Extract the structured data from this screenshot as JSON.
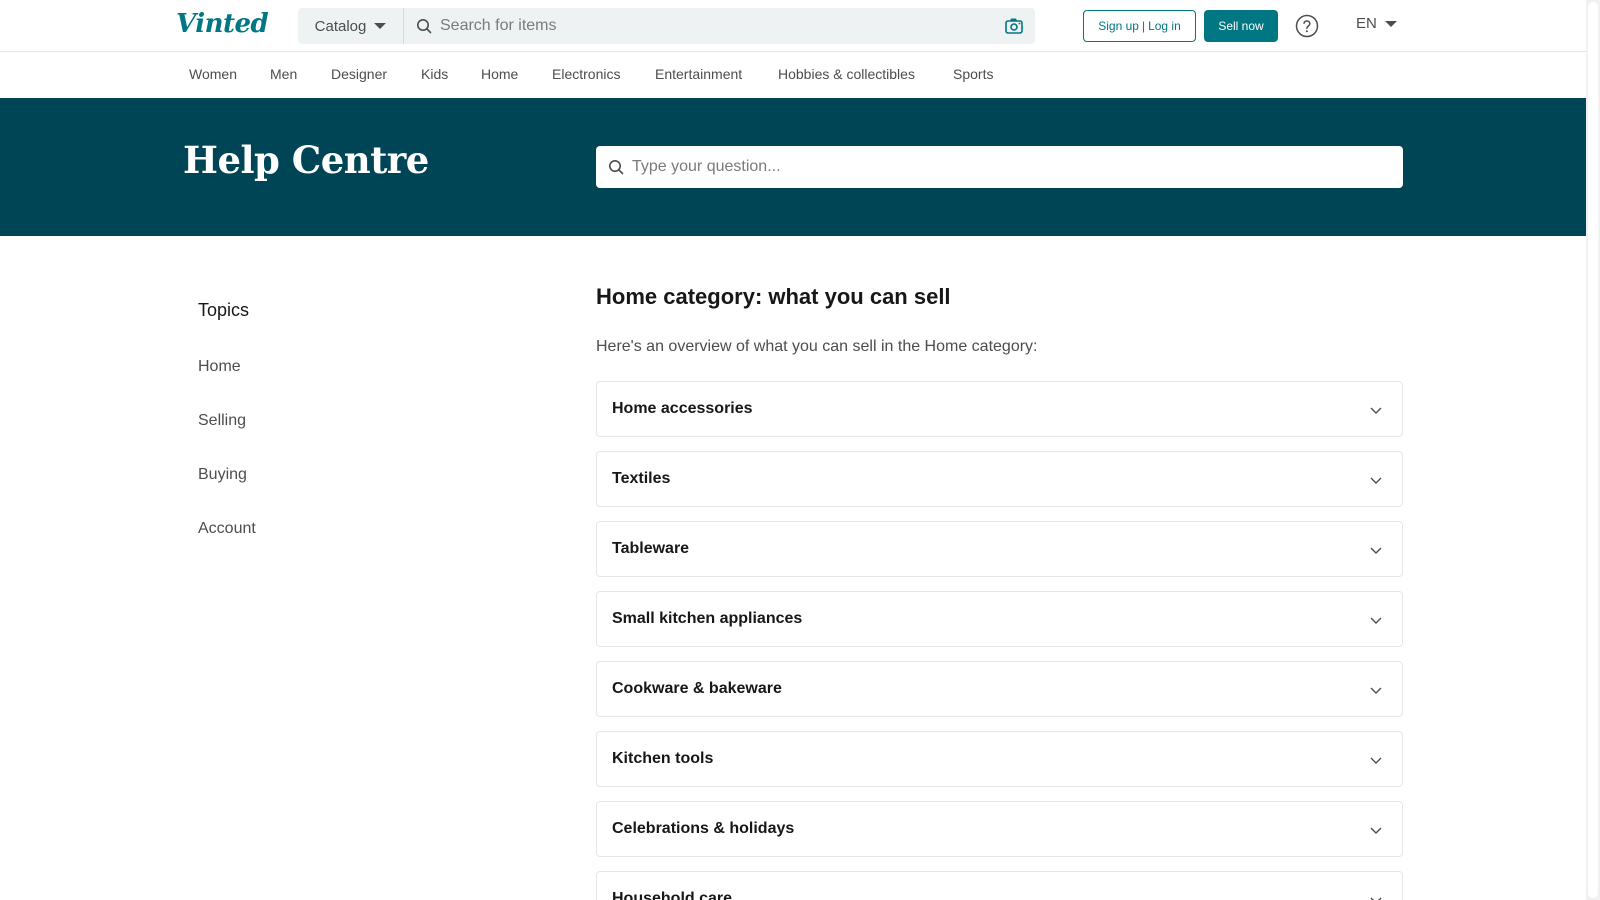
{
  "header": {
    "logo": "Vinted",
    "catalog_label": "Catalog",
    "search_placeholder": "Search for items",
    "signup_label": "Sign up",
    "separator": "|",
    "login_label": "Log in",
    "sell_label": "Sell now",
    "language": "EN"
  },
  "category_nav": [
    "Women",
    "Men",
    "Designer",
    "Kids",
    "Home",
    "Electronics",
    "Entertainment",
    "Hobbies & collectibles",
    "Sports"
  ],
  "hero": {
    "title": "Help Centre",
    "search_placeholder": "Type your question..."
  },
  "sidebar": {
    "title": "Topics",
    "items": [
      "Home",
      "Selling",
      "Buying",
      "Account"
    ]
  },
  "article": {
    "title": "Home category: what you can sell",
    "intro": "Here's an overview of what you can sell in the Home category:",
    "sections": [
      "Home accessories",
      "Textiles",
      "Tableware",
      "Small kitchen appliances",
      "Cookware & bakeware",
      "Kitchen tools",
      "Celebrations & holidays",
      "Household care"
    ]
  },
  "colors": {
    "brand": "#007782",
    "hero_bg": "#004556"
  }
}
